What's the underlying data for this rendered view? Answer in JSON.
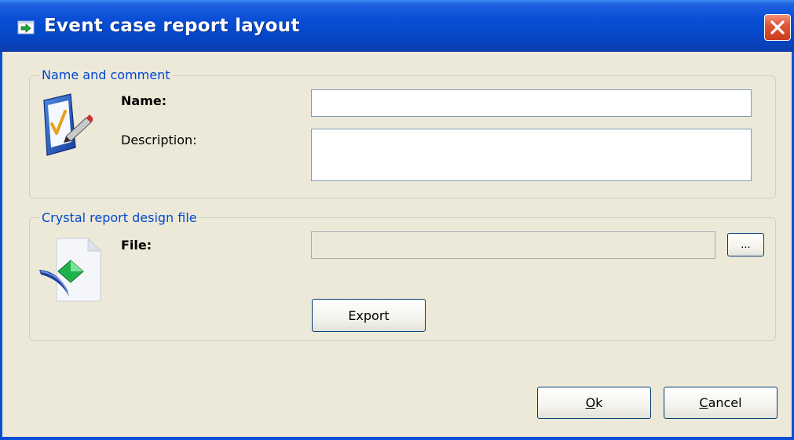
{
  "window": {
    "title": "Event case report layout",
    "title_icon": "report-layout-icon",
    "close_icon": "close-icon",
    "colors": {
      "titlebar": "#0A4FD6",
      "background": "#ECE9D8",
      "legend_text": "#0046D5",
      "close": "#E0573A"
    }
  },
  "name_group": {
    "legend": "Name and comment",
    "icon": "checklist-edit-icon",
    "name_label": "Name:",
    "name_value": "",
    "description_label": "Description:",
    "description_value": ""
  },
  "file_group": {
    "legend": "Crystal report design file",
    "icon": "crystal-report-file-icon",
    "file_label": "File:",
    "file_value": "",
    "browse_label": "...",
    "export_label": "Export"
  },
  "buttons": {
    "ok_mnemonic": "O",
    "ok_rest": "k",
    "cancel_mnemonic": "C",
    "cancel_rest": "ancel"
  }
}
